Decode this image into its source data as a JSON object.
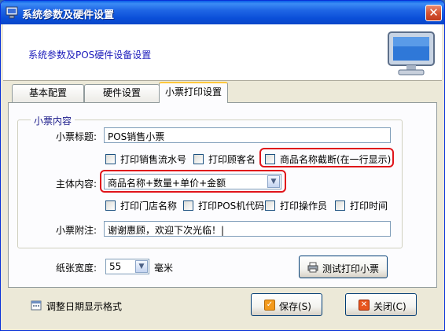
{
  "window": {
    "title": "系统参数及硬件设置",
    "close_label": "✕"
  },
  "banner": {
    "text": "系统参数及POS硬件设备设置",
    "icon": "monitor-icon"
  },
  "tabs": [
    {
      "label": "基本配置"
    },
    {
      "label": "硬件设置"
    },
    {
      "label": "小票打印设置"
    }
  ],
  "receipt": {
    "group_label": "小票内容",
    "title_label": "小票标题:",
    "title_value": "POS销售小票",
    "checkboxes_row1": [
      {
        "label": "打印销售流水号"
      },
      {
        "label": "打印顾客名"
      },
      {
        "label": "商品名称截断(在一行显示)"
      }
    ],
    "body_label": "主体内容:",
    "body_value": "商品名称+数量+单价+金额",
    "checkboxes_row2": [
      {
        "label": "打印门店名称"
      },
      {
        "label": "打印POS机代码"
      },
      {
        "label": "打印操作员"
      },
      {
        "label": "打印时间"
      }
    ],
    "note_label": "小票附注:",
    "note_value": "谢谢惠顾，欢迎下次光临！|"
  },
  "paper": {
    "label": "纸张宽度:",
    "value": "55",
    "unit": "毫米"
  },
  "test_print_label": "测试打印小票",
  "date_format_label": "调整日期显示格式",
  "save_label": "保存(S)",
  "close_button_label": "关闭(C)",
  "colors": {
    "highlight": "#e0141a",
    "title_bar": "#0a5ee8",
    "banner_text": "#1b1bbb"
  }
}
